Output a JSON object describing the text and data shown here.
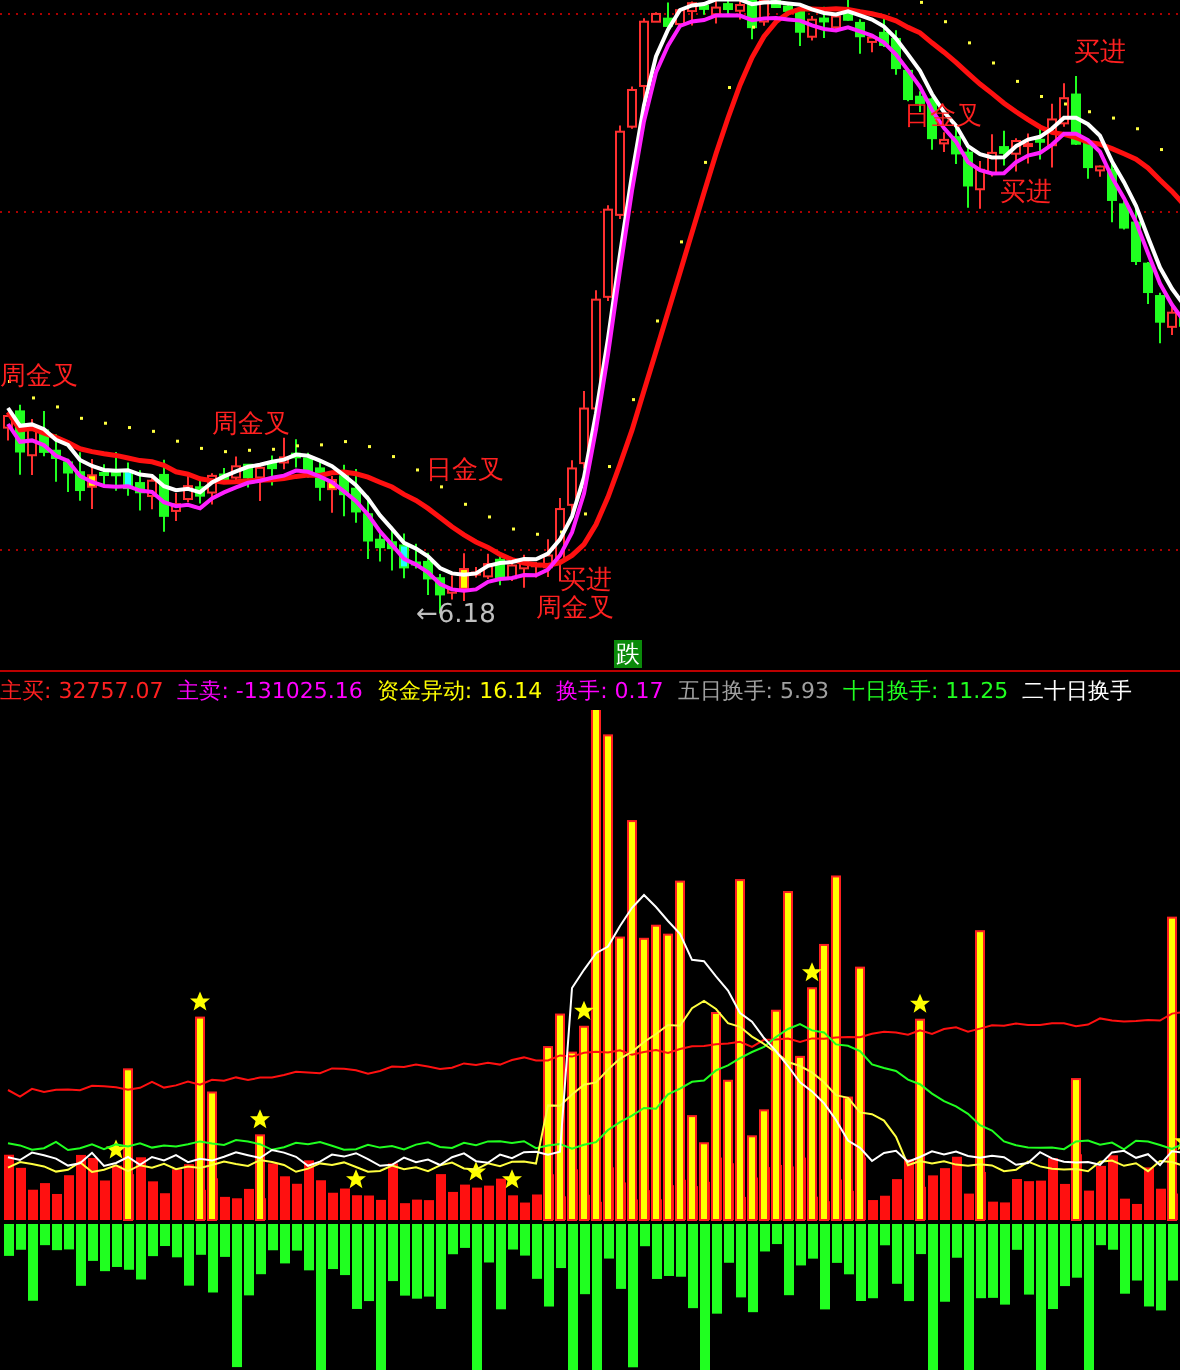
{
  "price_chart": {
    "labels": [
      {
        "text": "周金叉",
        "color": "#ff2020"
      },
      {
        "text": "周金叉",
        "color": "#ff2020"
      },
      {
        "text": "日金叉",
        "color": "#ff2020"
      },
      {
        "text": "买进",
        "color": "#ff2020"
      },
      {
        "text": "周金叉",
        "color": "#ff2020"
      },
      {
        "text": "←6.18",
        "color": "#c0c0c0"
      },
      {
        "text": "日金叉",
        "color": "#ff2020"
      },
      {
        "text": "买进",
        "color": "#ff2020"
      },
      {
        "text": "买进",
        "color": "#ff2020"
      }
    ],
    "badge": "跌"
  },
  "indicator_bar": {
    "items": [
      {
        "label": "主买: 32757.07",
        "color": "#ff2020"
      },
      {
        "label": "主卖: -131025.16",
        "color": "#ff00ff"
      },
      {
        "label": "资金异动: 16.14",
        "color": "#ffff00"
      },
      {
        "label": "换手: 0.17",
        "color": "#ff00ff"
      },
      {
        "label": "五日换手: 5.93",
        "color": "#a0a0a0"
      },
      {
        "label": "十日换手: 11.25",
        "color": "#20ff20"
      },
      {
        "label": "二十日换手",
        "color": "#ffffff"
      }
    ]
  }
}
